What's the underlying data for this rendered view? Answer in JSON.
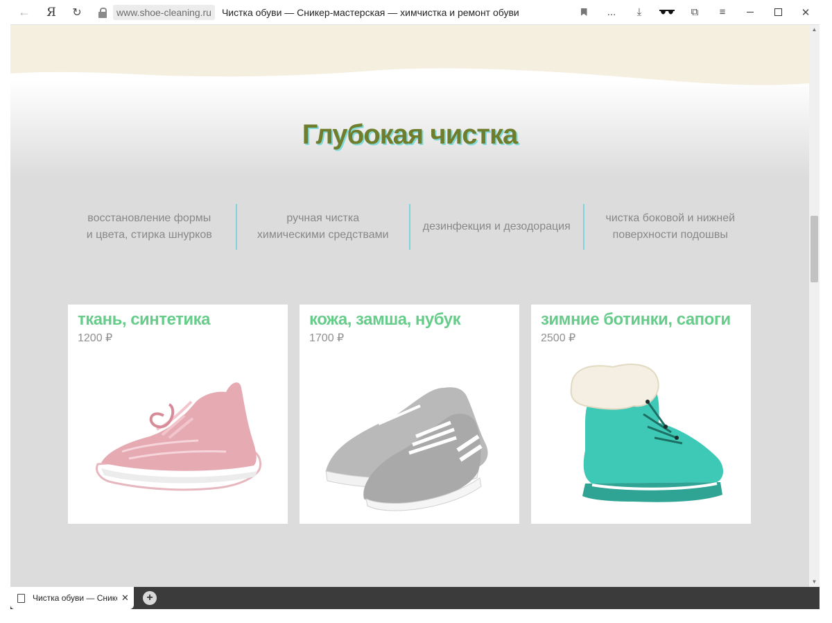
{
  "browser": {
    "icons": [
      "arrow-left-icon",
      "yandex-logo-icon",
      "reload-icon",
      "lock-icon",
      "bookmark-icon",
      "more-icon",
      "download-icon",
      "incognito-glasses-icon",
      "collections-icon",
      "menu-icon",
      "minimize-icon",
      "maximize-icon",
      "close-icon"
    ],
    "back_glyph": "←",
    "logo_text": "Я",
    "reload_glyph": "↻",
    "domain": "www.shoe-cleaning.ru",
    "page_title": "Чистка обуви — Сникер-мастерская — химчистка и ремонт обуви",
    "more_label": "...",
    "download_glyph": "⤓",
    "glasses_glyph": "▾▾",
    "collections_glyph": "⧉",
    "menu_glyph": "≡",
    "close_glyph": "✕"
  },
  "section": {
    "title": "Глубокая чистка",
    "features": [
      {
        "line1": "восстановление формы",
        "line2": "и цвета, стирка шнурков"
      },
      {
        "line1": "ручная чистка",
        "line2": "химическими средствами"
      },
      {
        "line1": "дезинфекция и дезодорация",
        "line2": ""
      },
      {
        "line1": "чистка боковой и нижней",
        "line2": "поверхности подошвы"
      }
    ],
    "cards": [
      {
        "title": "ткань, синтетика",
        "price": "1200 ₽",
        "image": "pink-knit-sneaker"
      },
      {
        "title": "кожа, замша, нубук",
        "price": "1700 ₽",
        "image": "grey-suede-sneakers"
      },
      {
        "title": "зимние ботинки, сапоги",
        "price": "2500 ₽",
        "image": "turquoise-fur-winter-boot"
      }
    ]
  },
  "colors": {
    "title": "#6f7d2c",
    "title_shadow": "#7fd9d9",
    "card_title": "#66cc8a",
    "divider": "#7ed4db",
    "wave": "#f5efe0",
    "page_bg": "#dcdcdc"
  },
  "tabs": {
    "items": [
      {
        "title": "Чистка обуви — Сникер-мастерская — химчистка и ремонт обуви"
      }
    ],
    "close_glyph": "✕",
    "new_tab_glyph": "+"
  },
  "scrollbar": {
    "position": 0.38
  }
}
